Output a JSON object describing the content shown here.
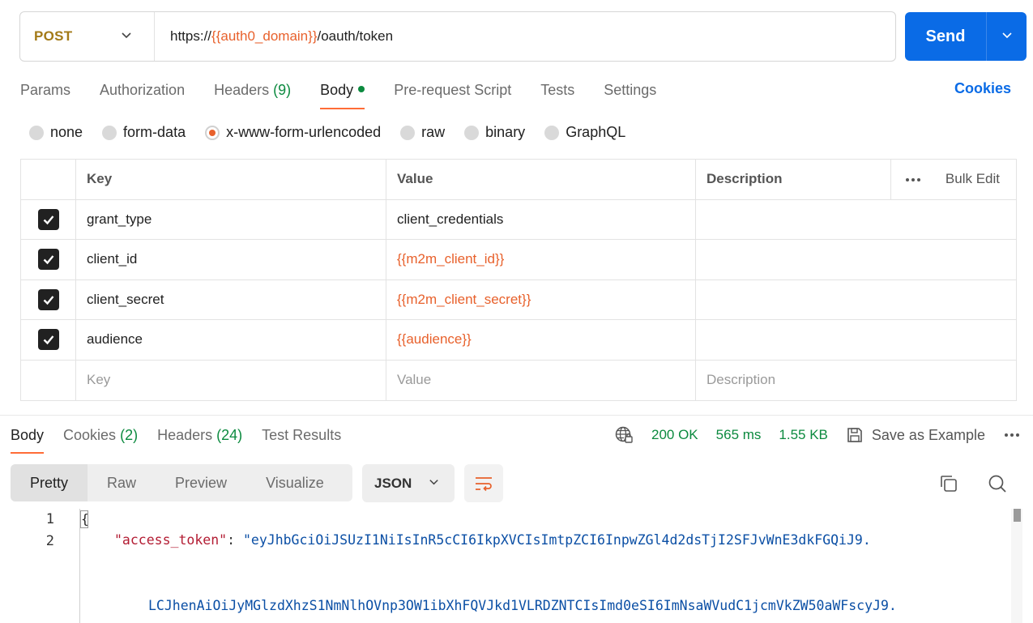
{
  "request": {
    "method": "POST",
    "url_prefix": "https://",
    "url_var": "{{auth0_domain}}",
    "url_suffix": "/oauth/token",
    "send_label": "Send"
  },
  "req_tabs": {
    "params": "Params",
    "authorization": "Authorization",
    "headers": "Headers",
    "headers_count": "(9)",
    "body": "Body",
    "prerequest": "Pre-request Script",
    "tests": "Tests",
    "settings": "Settings",
    "cookies": "Cookies"
  },
  "body_types": {
    "none": "none",
    "form_data": "form-data",
    "urlencoded": "x-www-form-urlencoded",
    "raw": "raw",
    "binary": "binary",
    "graphql": "GraphQL",
    "selected": "x-www-form-urlencoded"
  },
  "params_table": {
    "headers": {
      "key": "Key",
      "value": "Value",
      "description": "Description",
      "bulk_edit": "Bulk Edit"
    },
    "rows": [
      {
        "key": "grant_type",
        "value": "client_credentials",
        "checked": true
      },
      {
        "key": "client_id",
        "value": "{{m2m_client_id}}",
        "checked": true
      },
      {
        "key": "client_secret",
        "value": "{{m2m_client_secret}}",
        "checked": true
      },
      {
        "key": "audience",
        "value": "{{audience}}",
        "checked": true
      }
    ],
    "placeholder": {
      "key": "Key",
      "value": "Value",
      "description": "Description"
    }
  },
  "response": {
    "tabs": {
      "body": "Body",
      "cookies": "Cookies",
      "cookies_count": "(2)",
      "headers": "Headers",
      "headers_count": "(24)",
      "test_results": "Test Results"
    },
    "status": "200 OK",
    "time": "565 ms",
    "size": "1.55 KB",
    "save_example": "Save as Example",
    "views": {
      "pretty": "Pretty",
      "raw": "Raw",
      "preview": "Preview",
      "visualize": "Visualize"
    },
    "format": "JSON",
    "lines": {
      "n1": "1",
      "n2": "2",
      "brace": "{",
      "key": "\"access_token\"",
      "colon": ": ",
      "value_part1": "\"eyJhbGciOiJSUzI1NiIsInR5cCI6IkpXVCIsImtpZCI6InpwZGl4d2dsTjI2SFJvWnE3dkFGQiJ9.",
      "value_part2": "LCJhenAiOiJyMGlzdXhzS1NmNlhOVnp3OW1ibXhFQVJkd1VLRDZNTCIsImd0eSI6ImNsaWVudC1jcmVkZW50aWFscyJ9."
    }
  },
  "colors": {
    "accent_orange": "#ff6c37",
    "variable": "#e8612c",
    "send_blue": "#0a6be6",
    "success_green": "#0c8a3f",
    "method_post": "#a37a17"
  }
}
